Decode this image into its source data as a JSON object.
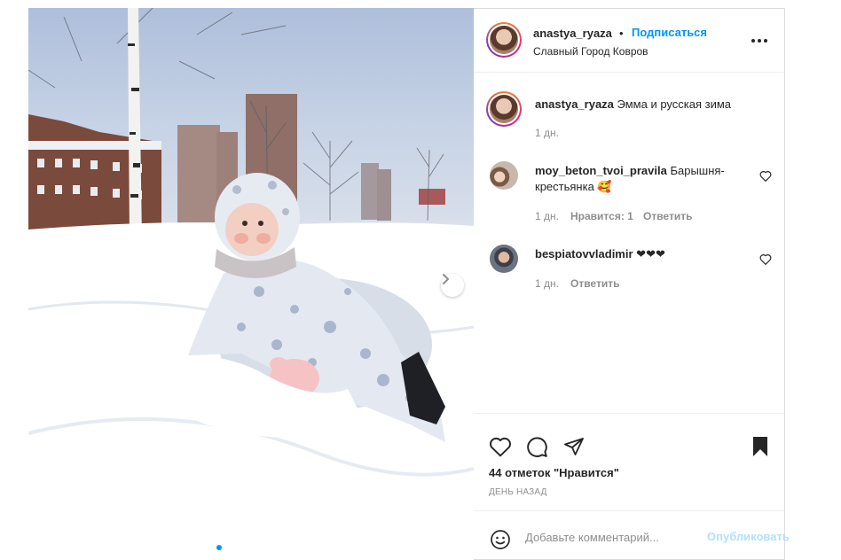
{
  "post": {
    "author": "anastya_ryaza",
    "follow_dot": "•",
    "follow_label": "Подписаться",
    "location": "Славный Город Ковров",
    "caption_author": "anastya_ryaza",
    "caption_text": "Эмма и русская зима",
    "caption_time": "1 дн."
  },
  "comments": [
    {
      "username": "moy_beton_tvoi_pravila",
      "text": "Барышня-крестьянка 🥰",
      "time": "1 дн.",
      "likes": "Нравится: 1",
      "reply": "Ответить"
    },
    {
      "username": "bespiatovvladimir",
      "text": "❤❤❤",
      "time": "1 дн.",
      "reply": "Ответить"
    }
  ],
  "actions": {
    "likes_text": "44 отметок \"Нравится\"",
    "date_text": "ДЕНЬ НАЗАД"
  },
  "add_comment": {
    "placeholder": "Добавьте комментарий...",
    "publish_label": "Опубликовать"
  },
  "carousel": {
    "total": 8,
    "active_index": 1
  },
  "colors": {
    "link_blue": "#0095f6",
    "publish_disabled": "#b2dffc",
    "muted": "#8e8e8e"
  },
  "icons": [
    "more-options-icon",
    "heart-icon",
    "comment-icon",
    "share-icon",
    "save-bookmark-icon",
    "emoji-icon",
    "next-arrow-icon"
  ]
}
